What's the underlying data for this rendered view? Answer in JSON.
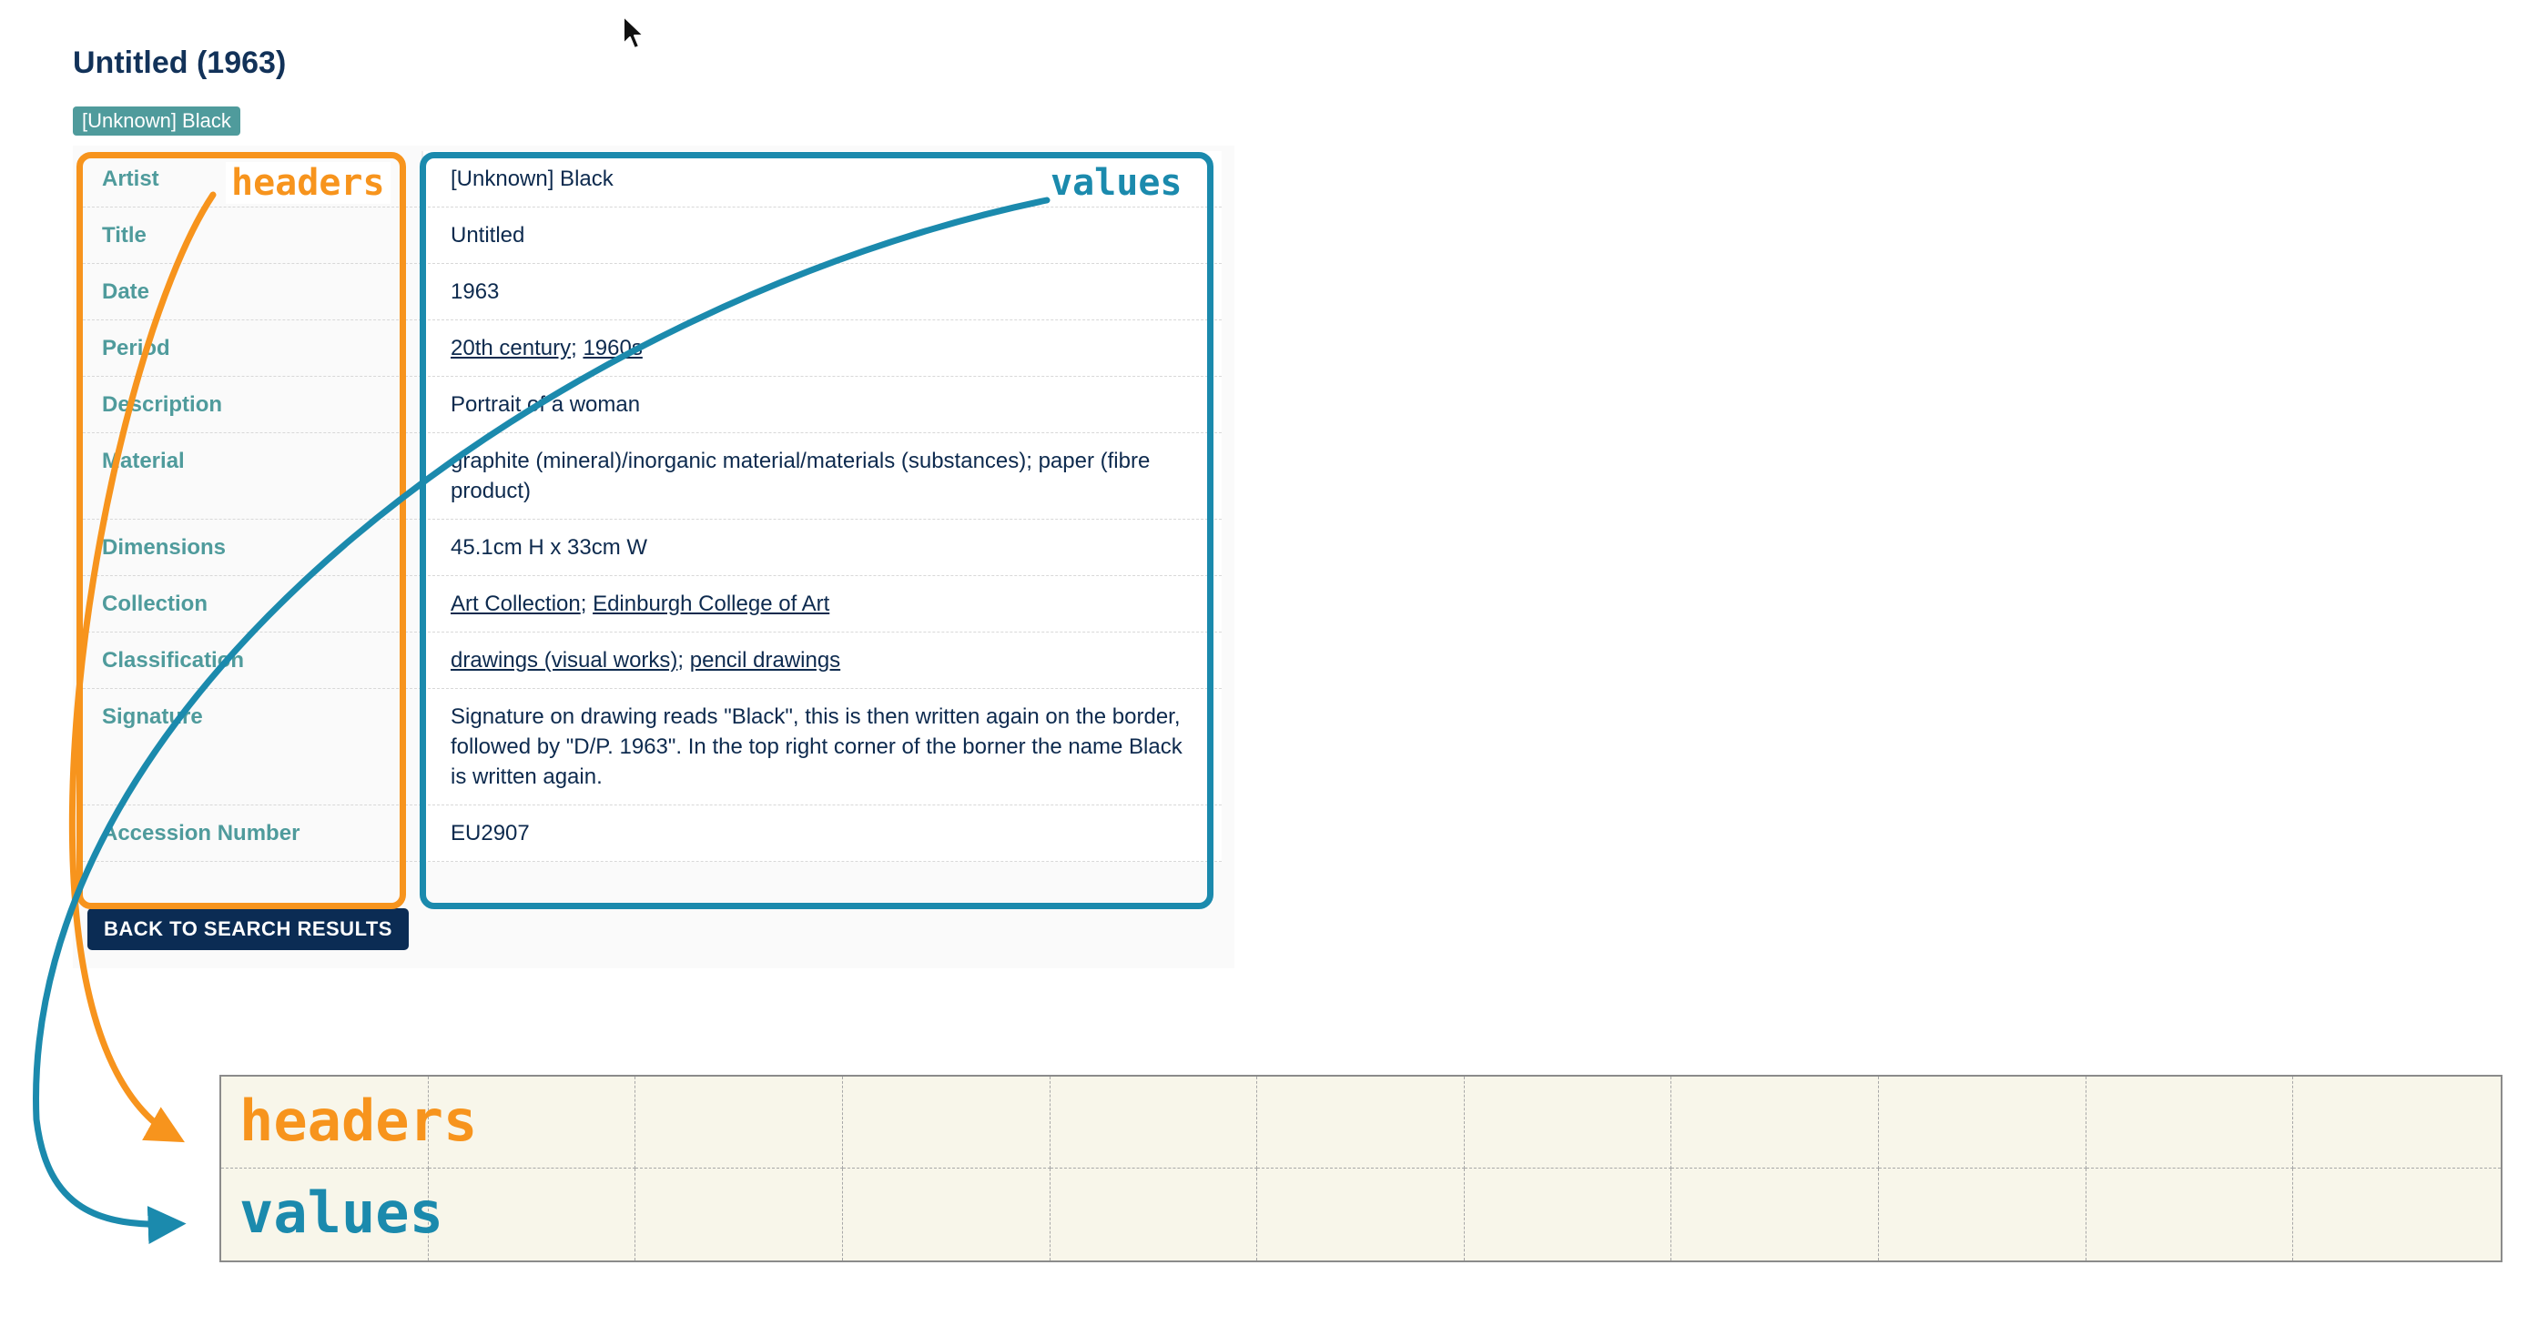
{
  "page": {
    "title": "Untitled (1963)",
    "artist_tag": "[Unknown] Black",
    "back_button": "BACK TO SEARCH RESULTS"
  },
  "metadata": [
    {
      "header": "Artist",
      "value": "[Unknown] Black"
    },
    {
      "header": "Title",
      "value": "Untitled"
    },
    {
      "header": "Date",
      "value": "1963"
    },
    {
      "header": "Period",
      "links": [
        "20th century",
        "1960s"
      ]
    },
    {
      "header": "Description",
      "value": "Portrait of a woman"
    },
    {
      "header": "Material",
      "value": "graphite (mineral)/inorganic material/materials (substances); paper (fibre product)"
    },
    {
      "header": "Dimensions",
      "value": "45.1cm H x 33cm W"
    },
    {
      "header": "Collection",
      "links": [
        "Art Collection",
        "Edinburgh College of Art"
      ]
    },
    {
      "header": "Classification",
      "links": [
        "drawings (visual works)",
        "pencil drawings"
      ]
    },
    {
      "header": "Signature",
      "value": "Signature on drawing reads \"Black\", this is then written again on the border, followed by \"D/P. 1963\". In the top right corner of the borner the name Black is written again."
    },
    {
      "header": "Accession Number",
      "value": "EU2907"
    }
  ],
  "link_separator": "; ",
  "annotations": {
    "headers_label": "headers",
    "values_label": "values",
    "headers_color": "#f7941d",
    "values_color": "#1b8aad"
  },
  "grid": {
    "columns": 11,
    "rows": 2,
    "row_labels": [
      "headers",
      "values"
    ]
  }
}
